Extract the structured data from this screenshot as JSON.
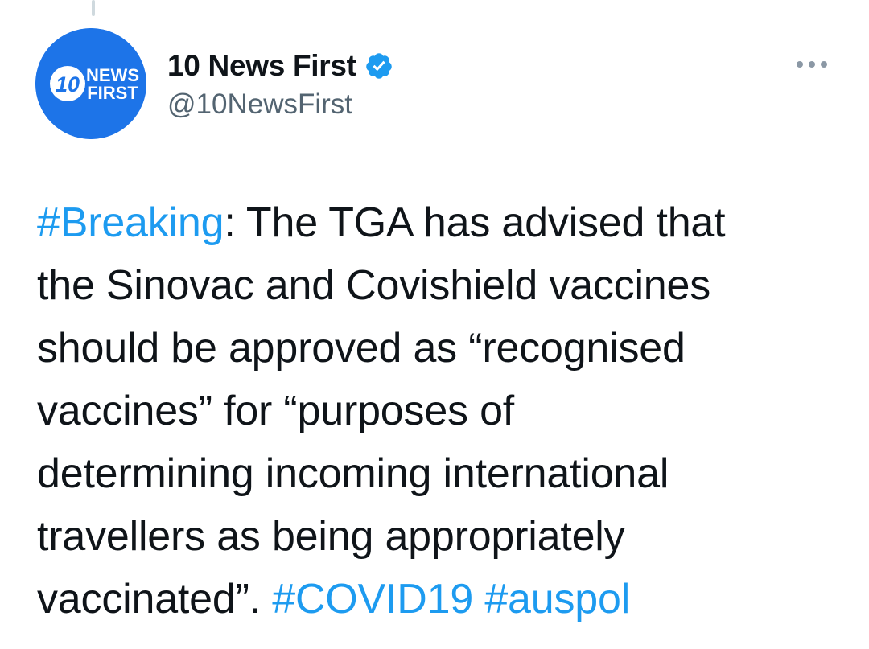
{
  "author": {
    "display_name": "10 News First",
    "handle": "@10NewsFirst",
    "verified": true,
    "avatar": {
      "icon": "10-news-first-logo",
      "logo_text_top": "NEWS",
      "logo_text_bottom": "FIRST",
      "logo_number": "10",
      "color": "#1d74e8"
    }
  },
  "menu": {
    "icon": "more-horizontal-icon"
  },
  "tweet": {
    "lines": [
      {
        "hashtag": "#Breaking",
        "text": ": The TGA has advised that"
      },
      {
        "text": "the Sinovac and Covishield vaccines"
      },
      {
        "text": "should be approved as “recognised"
      },
      {
        "text": "vaccines” for “purposes of"
      },
      {
        "text": "determining incoming international"
      },
      {
        "text": "travellers as being appropriately"
      },
      {
        "text": "vaccinated”. ",
        "hashtags": [
          "#COVID19",
          "#auspol"
        ]
      }
    ]
  },
  "colors": {
    "hashtag": "#1d9bf0",
    "text": "#0f1419",
    "secondary": "#536471",
    "verified": "#1d9bf0"
  }
}
